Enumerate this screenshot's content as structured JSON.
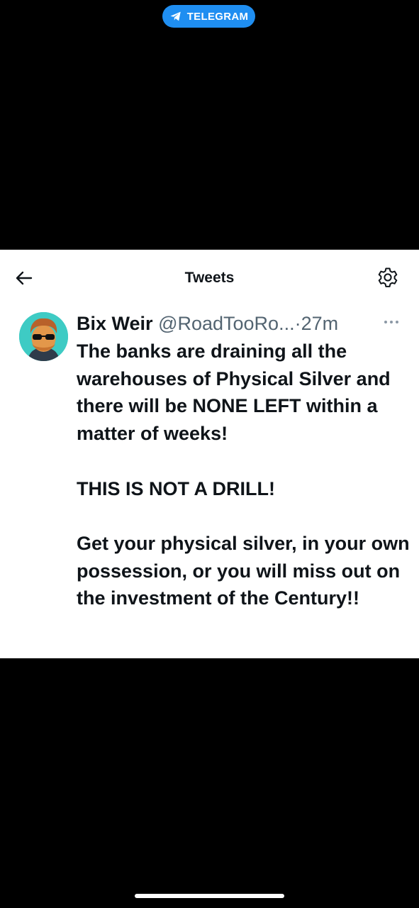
{
  "telegram_badge": {
    "label": "TELEGRAM",
    "color": "#1f8ef1",
    "icon": "telegram-paper-plane-icon"
  },
  "header": {
    "title": "Tweets",
    "back_icon": "arrow-left-icon",
    "settings_icon": "gear-icon"
  },
  "tweet": {
    "author_name": "Bix Weir",
    "author_handle": "@RoadTooRo...",
    "separator": "·",
    "timestamp": "27m",
    "more_icon": "more-horizontal-icon",
    "avatar_bg": "#3ecbc4",
    "body": "The banks are draining all the warehouses of Physical Silver and there will be NONE LEFT within a matter of weeks!\n\nTHIS IS NOT A DRILL!\n\nGet your physical silver, in your own possession, or you will miss out on the investment of the Century!!"
  },
  "colors": {
    "text_primary": "#0f1419",
    "text_secondary": "#536471",
    "background": "#000000",
    "card": "#ffffff"
  }
}
